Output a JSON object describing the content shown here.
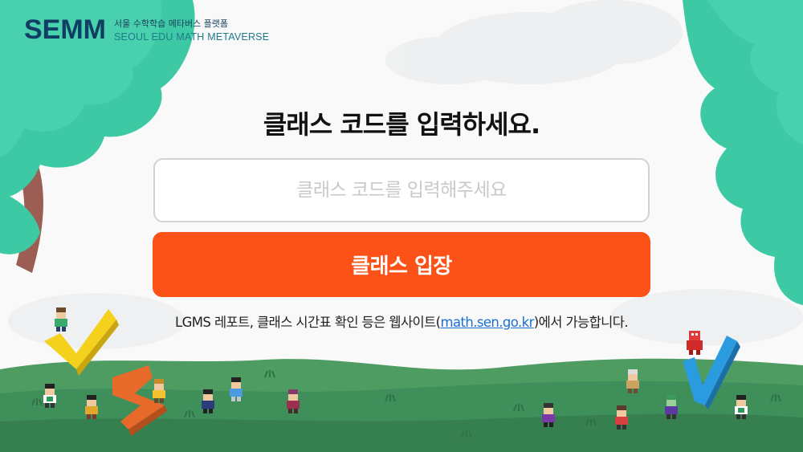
{
  "logo": {
    "mark": "SEMM",
    "tagline_kr": "서울 수학학습 메타버스 플랫폼",
    "tagline_en": "SEOUL EDU MATH METAVERSE"
  },
  "heading": "클래스 코드를 입력하세요.",
  "class_code": {
    "value": "",
    "placeholder": "클래스 코드를 입력해주세요"
  },
  "enter_button": "클래스 입장",
  "notice": {
    "before": "LGMS 레포트, 클래스 시간표 확인 등은 웹사이트(",
    "link": "math.sen.go.kr",
    "after": ")에서 가능합니다."
  },
  "colors": {
    "brand_navy": "#0f3d63",
    "accent_orange": "#fc5117",
    "link_blue": "#1b6fd6",
    "tree_green": "#3ec9a5",
    "grass_green": "#3f8f5a"
  }
}
